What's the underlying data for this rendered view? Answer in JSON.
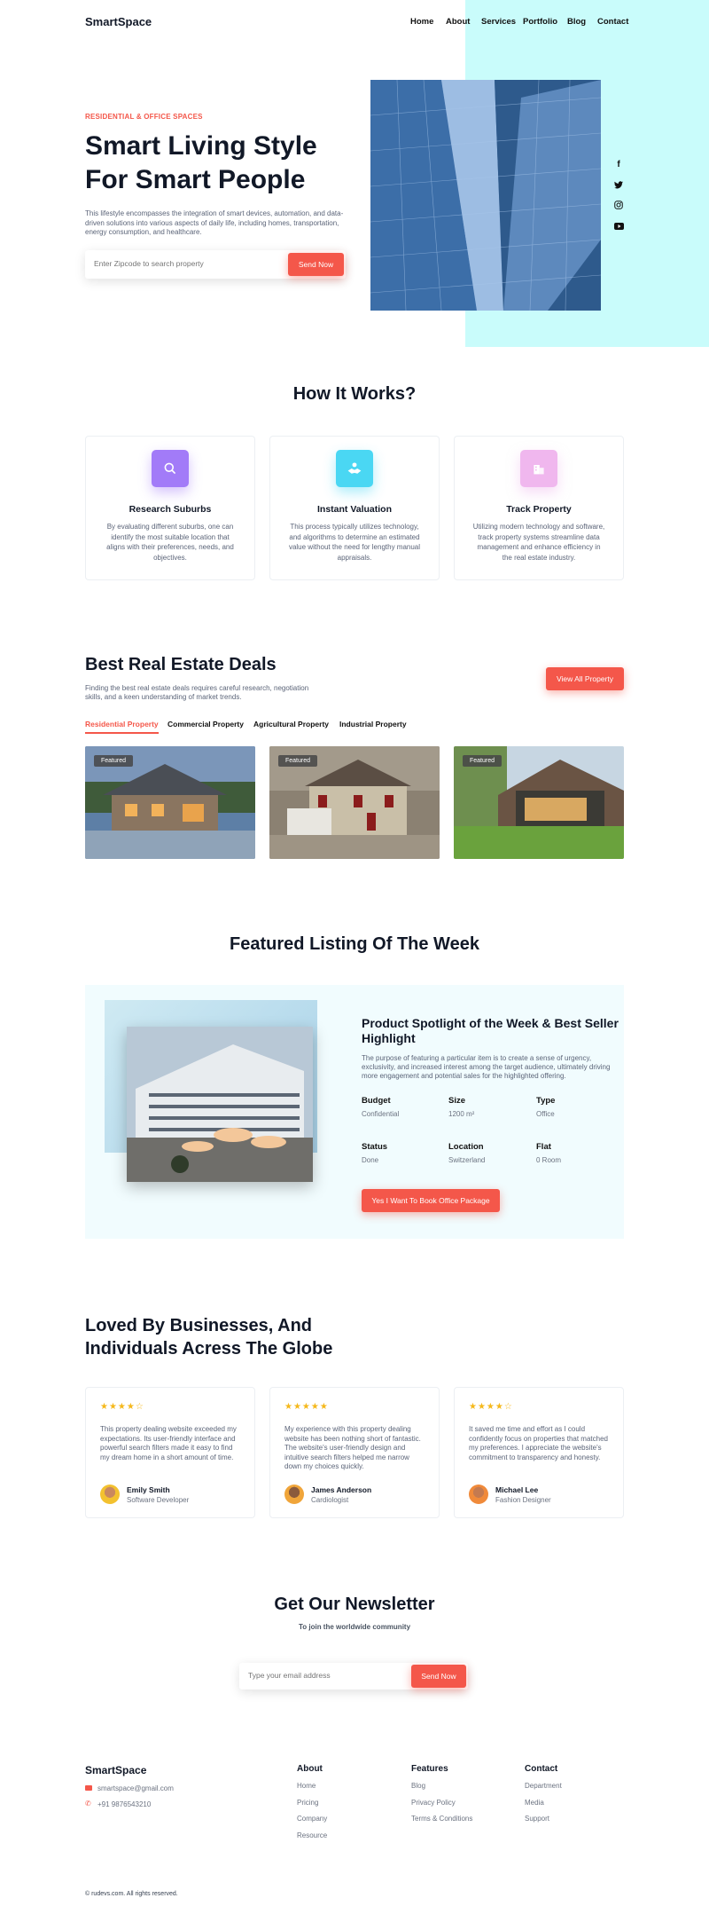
{
  "header": {
    "logo": "SmartSpace",
    "nav": [
      "Home",
      "About",
      "Services",
      "Portfolio",
      "Blog",
      "Contact"
    ]
  },
  "hero": {
    "tag": "RESIDENTIAL & OFFICE SPACES",
    "title": "Smart Living Style For Smart People",
    "description": "This lifestyle encompasses the integration of smart devices, automation, and data-driven solutions into various aspects of daily life, including homes, transportation, energy consumption, and healthcare.",
    "search_placeholder": "Enter Zipcode to search property",
    "search_button": "Send Now"
  },
  "social": [
    "f",
    "twitter",
    "instagram",
    "youtube"
  ],
  "how": {
    "title": "How It Works?",
    "cards": [
      {
        "title": "Research Suburbs",
        "text": "By evaluating different suburbs, one can identify the most suitable location that aligns with their preferences, needs, and objectives.",
        "color": "#a27bf8"
      },
      {
        "title": "Instant Valuation",
        "text": "This process typically utilizes technology, and algorithms to determine an estimated value without the need for lengthy manual appraisals.",
        "color": "#4ad7f3"
      },
      {
        "title": "Track Property",
        "text": "Utilizing modern technology and software, track property systems streamline data management and enhance efficiency in the real estate industry.",
        "color": "#f0b7ee"
      }
    ]
  },
  "deals": {
    "title": "Best Real Estate Deals",
    "description": "Finding the best real estate deals requires careful research, negotiation skills, and a keen understanding of market trends.",
    "button": "View All Property",
    "tabs": [
      "Residential Property",
      "Commercial Property",
      "Agricultural Property",
      "Industrial Property"
    ],
    "badge": "Featured"
  },
  "featured": {
    "title": "Featured Listing Of The Week",
    "heading": "Product Spotlight of the Week & Best Seller Highlight",
    "description": "The purpose of featuring a particular item is to create a sense of urgency, exclusivity, and increased interest among the target audience, ultimately driving more engagement and potential sales for the highlighted offering.",
    "specs": [
      {
        "label": "Budget",
        "value": "Confidential"
      },
      {
        "label": "Size",
        "value": "1200 m²"
      },
      {
        "label": "Type",
        "value": "Office"
      },
      {
        "label": "Status",
        "value": "Done"
      },
      {
        "label": "Location",
        "value": "Switzerland"
      },
      {
        "label": "Flat",
        "value": "0 Room"
      }
    ],
    "button": "Yes I Want To Book Office Package"
  },
  "testimonials": {
    "title": "Loved By Businesses, And Individuals Acress The Globe",
    "items": [
      {
        "stars": "★★★★☆",
        "text": "This property dealing website exceeded my expectations. Its user-friendly interface and powerful search filters made it easy to find my dream home in a short amount of time.",
        "name": "Emily Smith",
        "role": "Software Developer"
      },
      {
        "stars": "★★★★★",
        "text": "My experience with this property dealing website has been nothing short of fantastic. The website's user-friendly design and intuitive search filters helped me narrow down my choices quickly.",
        "name": "James Anderson",
        "role": "Cardiologist"
      },
      {
        "stars": "★★★★☆",
        "text": "It saved me time and effort as I could confidently focus on properties that matched my preferences. I appreciate the website's commitment to transparency and honesty.",
        "name": "Michael Lee",
        "role": "Fashion Designer"
      }
    ]
  },
  "newsletter": {
    "title": "Get Our Newsletter",
    "subtitle": "To join the worldwide community",
    "placeholder": "Type your email address",
    "button": "Send Now"
  },
  "footer": {
    "logo": "SmartSpace",
    "email": "smartspace@gmail.com",
    "phone": "+91 9876543210",
    "about": {
      "title": "About",
      "links": [
        "Home",
        "Pricing",
        "Company",
        "Resource"
      ]
    },
    "features": {
      "title": "Features",
      "links": [
        "Blog",
        "Privacy Policy",
        "Terms & Conditions"
      ]
    },
    "contact": {
      "title": "Contact",
      "links": [
        "Department",
        "Media",
        "Support"
      ]
    },
    "copyright": "© rudevs.com. All rights reserved."
  }
}
